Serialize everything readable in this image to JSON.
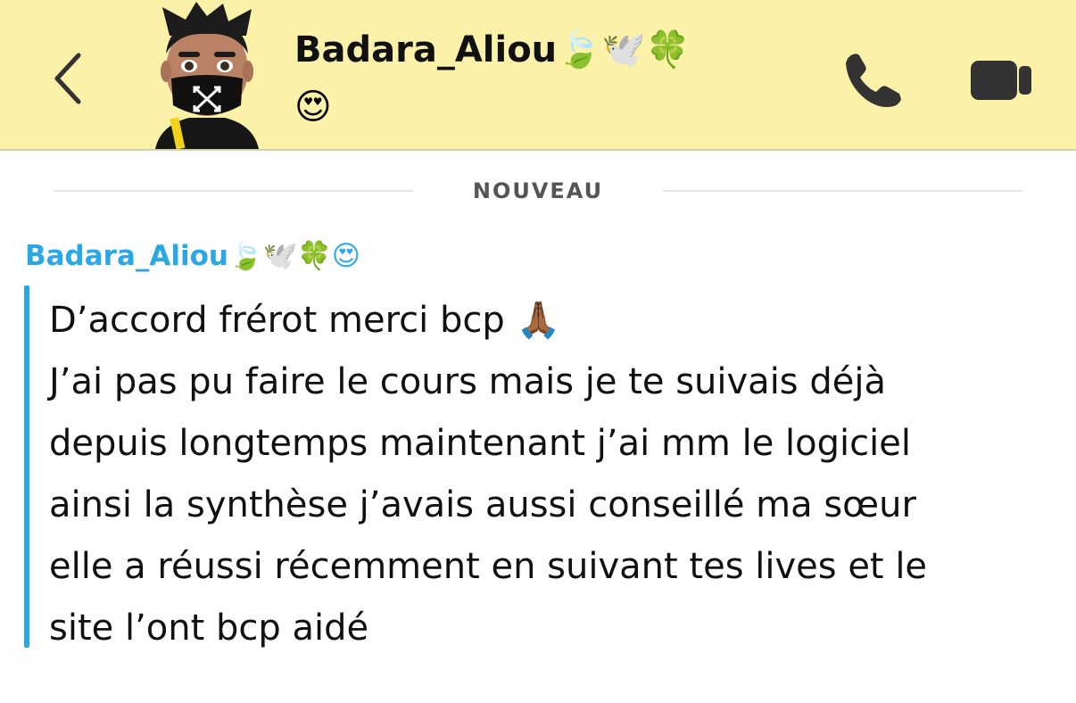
{
  "header": {
    "contact_name": "Badara_Aliou",
    "name_emojis": "🍃🕊️🍀",
    "status_emoji": "😍",
    "icons": {
      "back": "chevron-left-icon",
      "call": "phone-icon",
      "video": "video-camera-icon"
    },
    "colors": {
      "background": "#fbf1a9",
      "icon": "#333333"
    }
  },
  "divider": {
    "label": "NOUVEAU"
  },
  "message": {
    "sender_name": "Badara_Aliou",
    "sender_emojis": "🍃🕊️🍀😍",
    "sender_color": "#2aa8e6",
    "lines": [
      "D’accord frérot merci bcp 🙏🏾",
      "J’ai pas pu faire le cours mais je te suivais déjà",
      "depuis longtemps maintenant j’ai mm le logiciel",
      "ainsi la synthèse j’avais aussi conseillé ma sœur",
      "elle a réussi récemment en suivant tes lives et le",
      "site l’ont bcp aidé"
    ]
  }
}
